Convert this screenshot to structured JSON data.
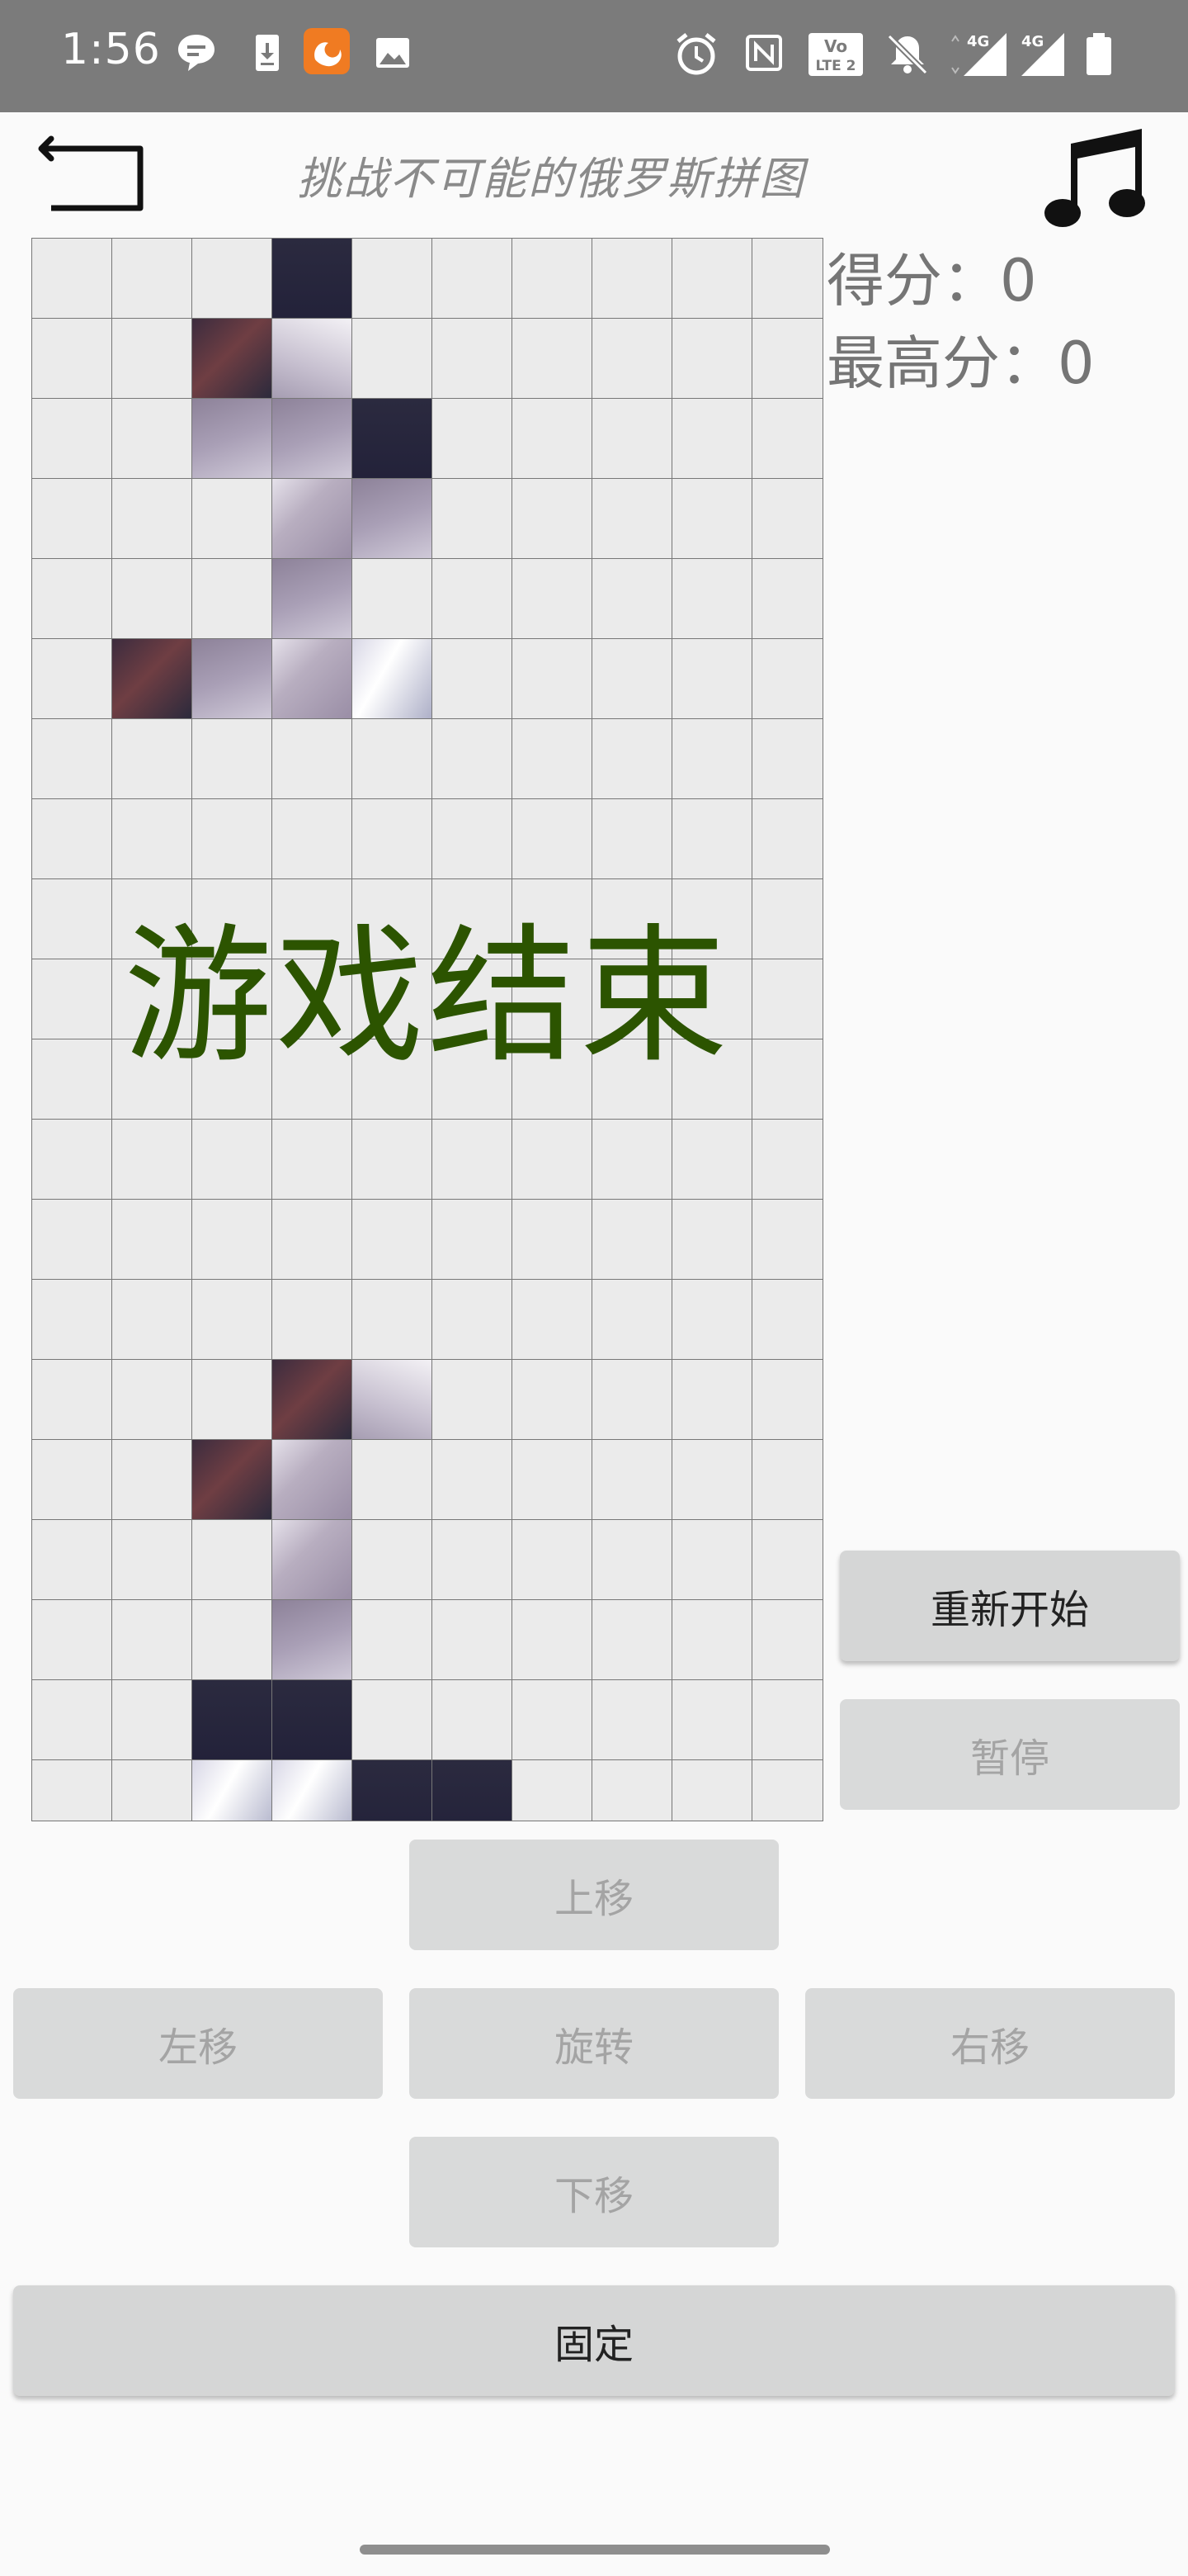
{
  "status_bar": {
    "time": "1:56",
    "left_icons": [
      "message-icon",
      "download-icon",
      "uc-browser-icon",
      "image-icon"
    ],
    "right_icons": [
      "alarm-icon",
      "nfc-icon",
      "volte-icon",
      "mute-icon",
      "signal-4g-icon",
      "signal-4g-icon",
      "battery-icon"
    ],
    "network_label_1": "4G",
    "network_label_2": "4G",
    "volte_label": "LTE 2",
    "brand_orange": "#f07b22"
  },
  "header": {
    "back_icon": "back-arrow-icon",
    "title": "挑战不可能的俄罗斯拼图",
    "music_icon": "music-note-icon"
  },
  "score": {
    "score_label": "得分：0",
    "high_score_label": "最高分：0"
  },
  "game": {
    "status_text": "游戏结束",
    "status_color": "#2c5400",
    "columns": 10,
    "rows": 20,
    "filled_cells": [
      [
        0,
        3,
        "c"
      ],
      [
        1,
        2,
        "d"
      ],
      [
        1,
        3,
        "e"
      ],
      [
        2,
        2,
        "b"
      ],
      [
        2,
        3,
        "b"
      ],
      [
        2,
        4,
        "c"
      ],
      [
        3,
        3,
        "a"
      ],
      [
        3,
        4,
        "b"
      ],
      [
        4,
        3,
        "b"
      ],
      [
        5,
        1,
        "d"
      ],
      [
        5,
        2,
        "b"
      ],
      [
        5,
        3,
        "a"
      ],
      [
        5,
        4,
        "f"
      ],
      [
        14,
        3,
        "d"
      ],
      [
        14,
        4,
        "e"
      ],
      [
        15,
        2,
        "d"
      ],
      [
        15,
        3,
        "a"
      ],
      [
        16,
        3,
        "a"
      ],
      [
        17,
        3,
        "b"
      ],
      [
        18,
        2,
        "c"
      ],
      [
        18,
        3,
        "c"
      ],
      [
        19,
        2,
        "f"
      ],
      [
        19,
        3,
        "f"
      ],
      [
        19,
        4,
        "c"
      ],
      [
        19,
        5,
        "c"
      ]
    ]
  },
  "controls": {
    "restart": "重新开始",
    "pause": "暂停",
    "up": "上移",
    "left": "左移",
    "rotate": "旋转",
    "right": "右移",
    "down": "下移",
    "fix": "固定"
  }
}
